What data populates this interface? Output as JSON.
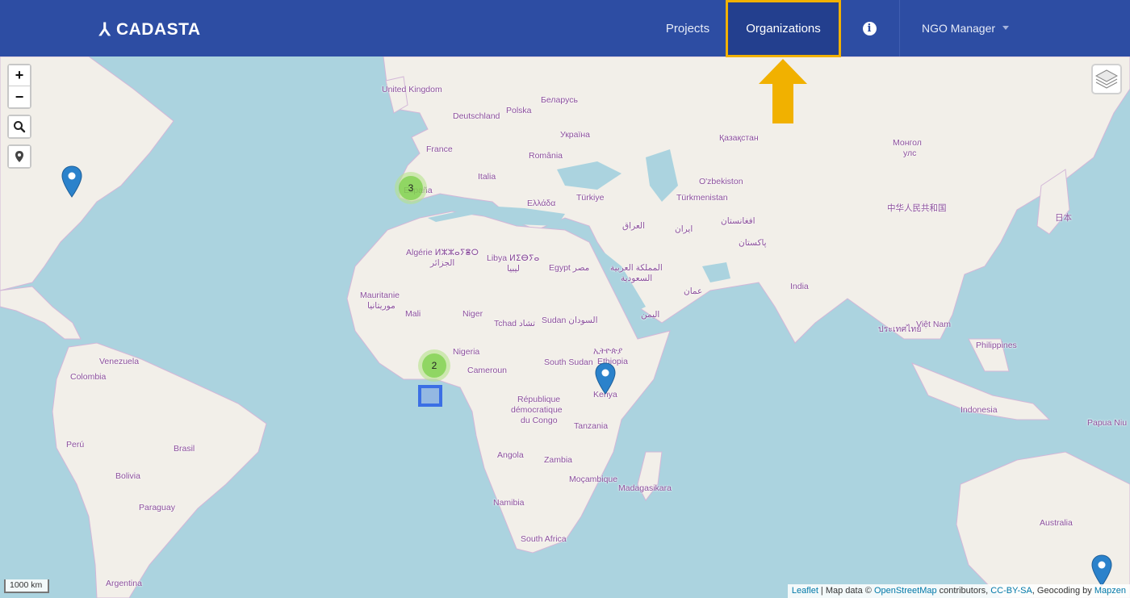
{
  "header": {
    "logo_text": "CADASTA",
    "logo_mark": "⅄",
    "nav": {
      "projects": "Projects",
      "organizations": "Organizations",
      "info_glyph": "i",
      "user": "NGO Manager"
    },
    "colors": {
      "bar": "#2d4da3",
      "active": "#233f8e",
      "highlight": "#f1b100"
    }
  },
  "map": {
    "controls": {
      "zoom_in": "+",
      "zoom_out": "−",
      "search_icon": "search-icon",
      "locate_icon": "map-marker-icon",
      "layers_icon": "layers-icon"
    },
    "clusters": [
      {
        "name": "cluster-spain",
        "count": "3"
      },
      {
        "name": "cluster-nigeria",
        "count": "2"
      }
    ],
    "places": {
      "united_kingdom": "United Kingdom",
      "belarus": "Беларусь",
      "polska": "Polska",
      "deutschland": "Deutschland",
      "ukraina": "Україна",
      "france": "France",
      "romania": "România",
      "kazakhstan": "Қазақстан",
      "mongol": "Монгол",
      "uls": "улс",
      "italia": "Italia",
      "uzbekiston": "O'zbekiston",
      "turkiye": "Türkiye",
      "turkmenistan": "Türkmenistan",
      "espana": "España",
      "ellada": "Ελλάδα",
      "afghanistan": "افغانستان",
      "china": "中华人民共和国",
      "japan": "日本",
      "iraq": "العراق",
      "iran": "ایران",
      "pakistan": "پاکستان",
      "algerie": "Algérie ⵍⵣⵣⴰⵢⴻⵔ",
      "algerie_ar": "الجزائر",
      "libya": "Libya ⵍⵉⴱⵢⴰ",
      "libya_ar": "ليبيا",
      "egypt": "Egypt مصر",
      "saudi": "المملكة العربية",
      "saudi2": "السعودية",
      "oman": "عمان",
      "india": "India",
      "mauritanie": "Mauritanie",
      "mauritanie_ar": "موريتانيا",
      "mali": "Mali",
      "niger": "Niger",
      "tchad": "Tchad تشاد",
      "sudan": "Sudan السودان",
      "yemen": "اليمن",
      "thailand": "ประเทศไทย",
      "vietnam": "Việt Nam",
      "venezuela": "Venezuela",
      "colombia": "Colombia",
      "nigeria": "Nigeria",
      "ethiopia_am": "ኢትዮጵያ",
      "south_sudan": "South Sudan",
      "ethiopia": "Ethiopia",
      "philippines": "Philippines",
      "cameroun": "Cameroun",
      "kenya": "Kenya",
      "rdc1": "République",
      "rdc2": "démocratique",
      "rdc3": "du Congo",
      "indonesia": "Indonesia",
      "papua": "Papua Niu",
      "tanzania": "Tanzania",
      "peru": "Perú",
      "brasil": "Brasil",
      "angola": "Angola",
      "zambia": "Zambia",
      "bolivia": "Bolivia",
      "mocambique": "Moçambique",
      "madagasikara": "Madagasikara",
      "paraguay": "Paraguay",
      "namibia": "Namibia",
      "australia": "Australia",
      "south_africa": "South Africa",
      "argentina": "Argentina"
    },
    "scale": "1000 km",
    "attribution": {
      "leaflet": "Leaflet",
      "sep1": " | Map data © ",
      "osm": "OpenStreetMap",
      "sep2": " contributors, ",
      "license": "CC-BY-SA",
      "sep3": ", Geocoding by ",
      "mapzen": "Mapzen"
    }
  }
}
